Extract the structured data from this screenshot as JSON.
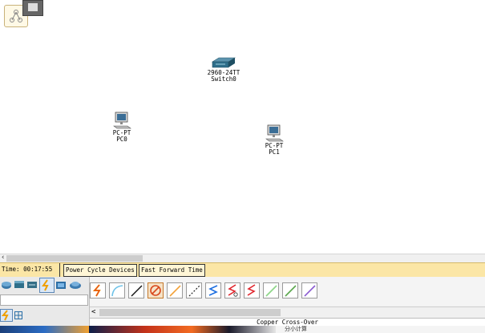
{
  "app": "Cisco Packet Tracer",
  "workspace": {
    "devices": [
      {
        "id": "switch0",
        "model": "2960-24TT",
        "name": "Switch0",
        "icon": "switch-icon"
      },
      {
        "id": "pc0",
        "model": "PC-PT",
        "name": "PC0",
        "icon": "pc-icon"
      },
      {
        "id": "pc1",
        "model": "PC-PT",
        "name": "PC1",
        "icon": "pc-icon"
      }
    ]
  },
  "timebar": {
    "time": "Time: 00:17:55",
    "power_cycle_label": "Power Cycle Devices",
    "fast_forward_label": "Fast Forward Time"
  },
  "device_panel": {
    "categories": [
      "router-icon",
      "switch-icon",
      "hub-icon",
      "connections-icon",
      "end-devices-icon",
      "wan-emulation-icon"
    ],
    "subcategories": [
      "connections-icon",
      "grid-icon"
    ]
  },
  "connections_panel": {
    "icons": [
      "automatic-connection-icon",
      "console-cable-icon",
      "copper-straight-through-icon",
      "copper-cross-over-icon",
      "fiber-icon",
      "phone-cable-icon",
      "coaxial-icon",
      "serial-dce-icon",
      "serial-dte-icon",
      "octal-cable-icon",
      "iot-custom-cable-icon",
      "usb-cable-icon"
    ],
    "selected_name": "Copper Cross-Over",
    "partial_text": "分小计算"
  },
  "colors": {
    "timebar": "#fbe6a6",
    "workspace": "#ffffff",
    "panel": "#efefef"
  }
}
